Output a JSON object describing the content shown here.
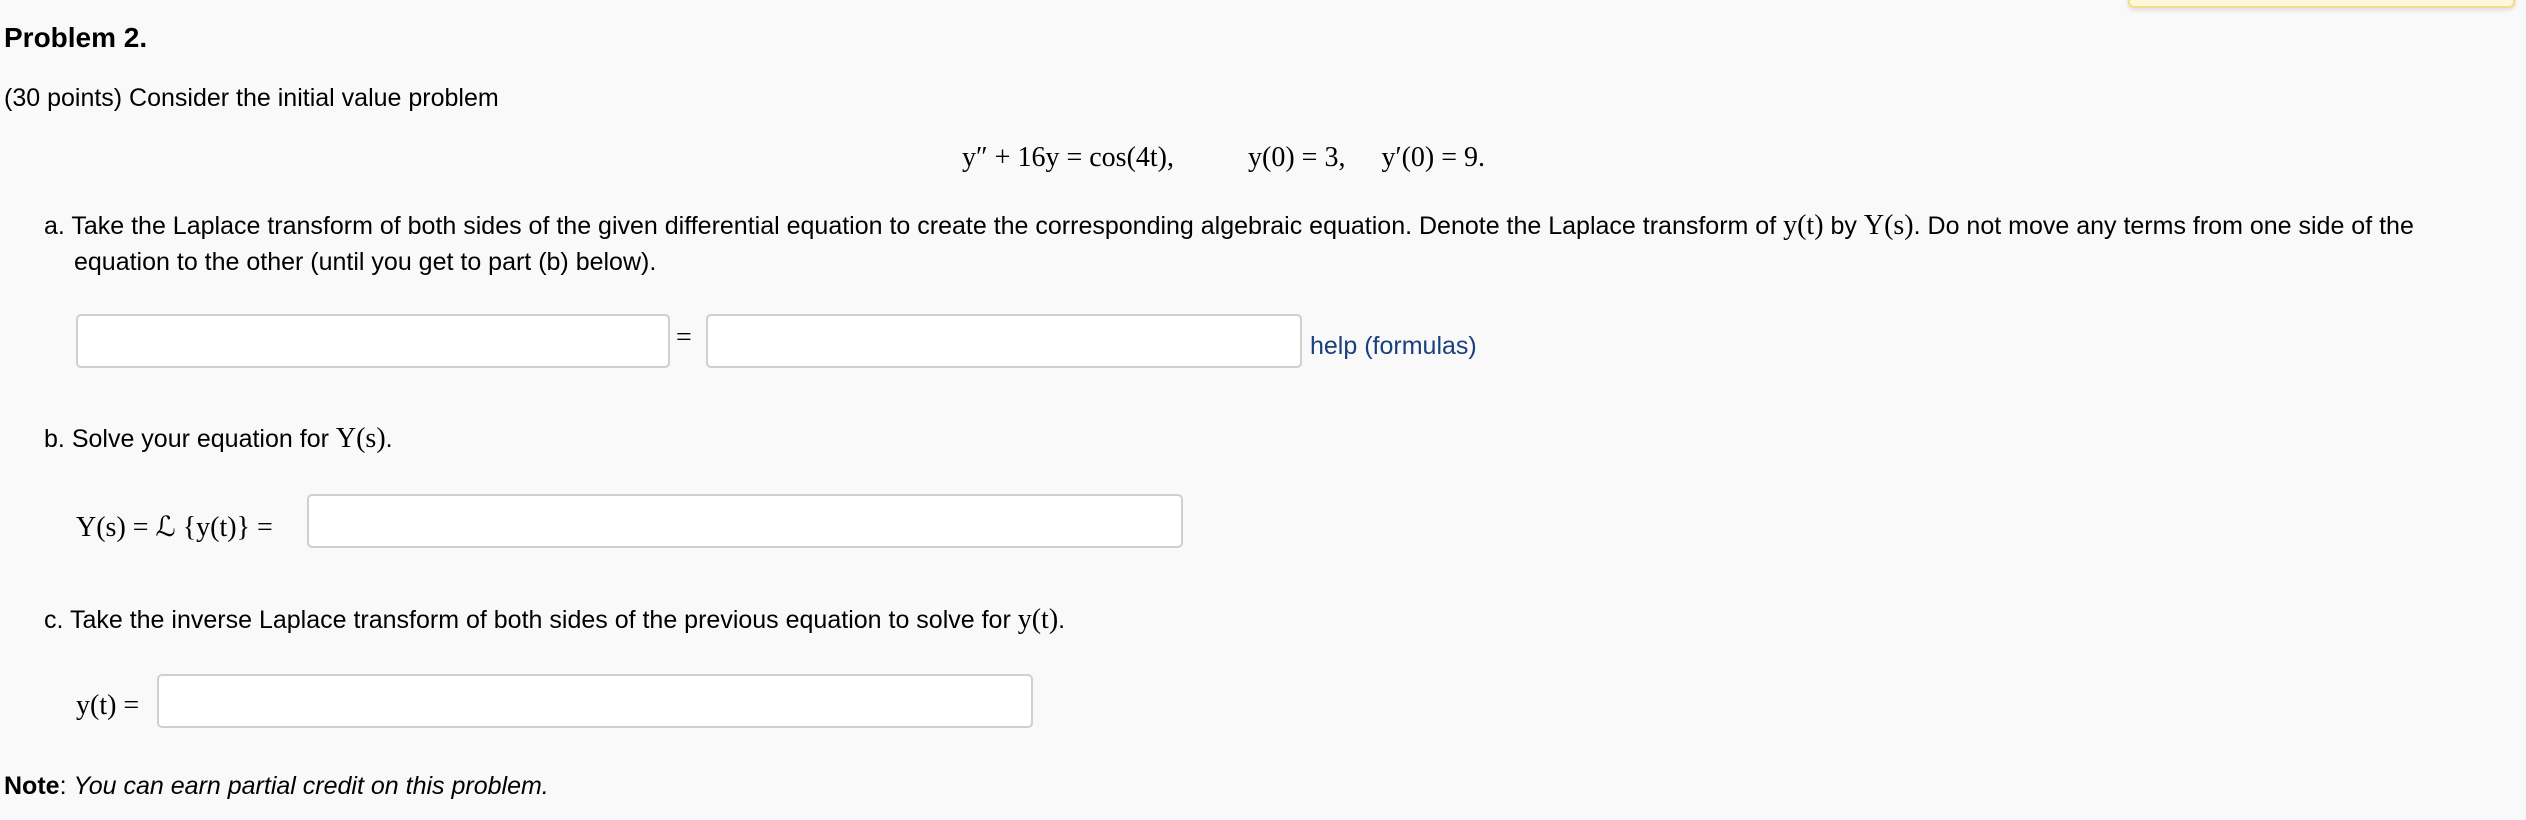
{
  "problem": {
    "title": "Problem 2.",
    "intro": "(30 points) Consider the initial value problem",
    "equation": {
      "ode": "y″ + 16y = cos(4t),",
      "ic1": "y(0) = 3,",
      "ic2": "y′(0) = 9."
    }
  },
  "part_a": {
    "marker": "a.",
    "text1": "Take the Laplace transform of both sides of the given differential equation to create the corresponding algebraic equation. Denote the Laplace transform of",
    "yt": "y(t)",
    "by": "by",
    "Ys": "Y(s)",
    "text2": ". Do not move any terms from one side of the",
    "text3": "equation to the other (until you get to part (b) below).",
    "equals": "=",
    "left_value": "",
    "right_value": "",
    "help_link": "help (formulas)"
  },
  "part_b": {
    "marker": "b.",
    "text": "Solve your equation for",
    "Ys": "Y(s)",
    "end": ".",
    "label": "Y(s) = ℒ {y(t)} =",
    "value": ""
  },
  "part_c": {
    "marker": "c.",
    "text": "Take the inverse Laplace transform of both sides of the previous equation to solve for",
    "yt": "y(t)",
    "end": ".",
    "label": "y(t) =",
    "value": ""
  },
  "note": {
    "bold": "Note",
    "colon": ": ",
    "text": "You can earn partial credit on this problem."
  }
}
